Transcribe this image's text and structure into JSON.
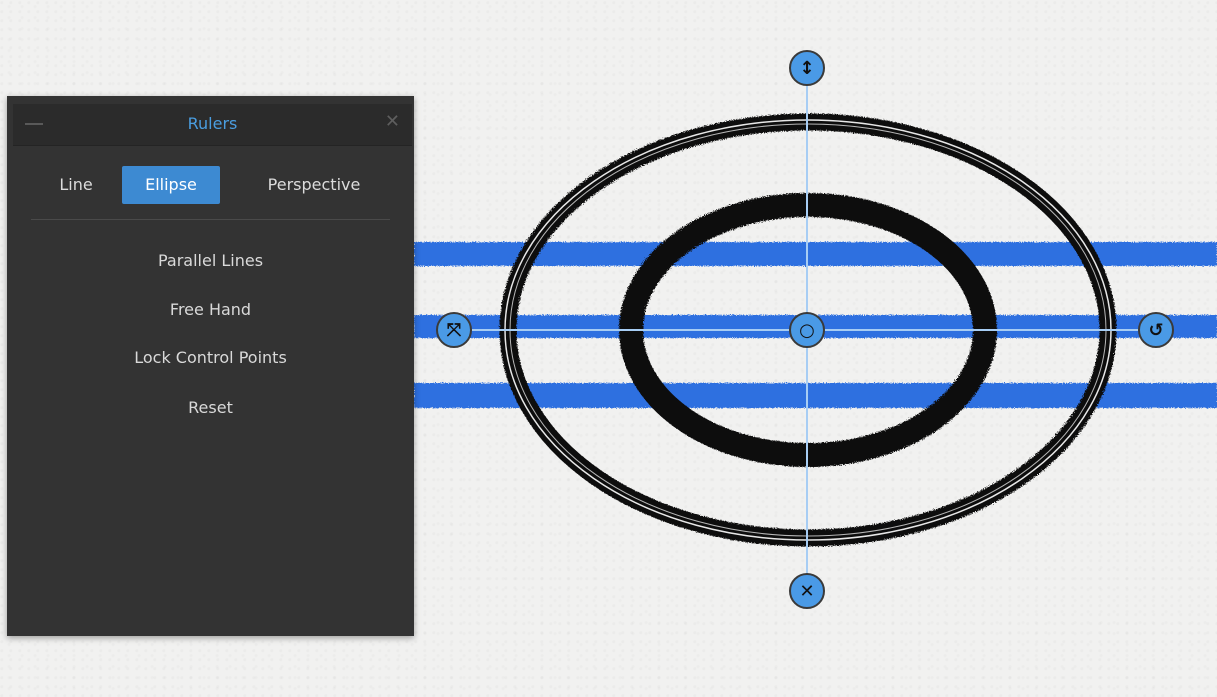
{
  "panel": {
    "title": "Rulers",
    "tabs": [
      {
        "label": "Line",
        "selected": false
      },
      {
        "label": "Ellipse",
        "selected": true
      },
      {
        "label": "Perspective",
        "selected": false
      }
    ],
    "menu_items": [
      "Parallel Lines",
      "Free Hand",
      "Lock Control Points",
      "Reset"
    ]
  },
  "handles": {
    "top": "vertical-resize-icon",
    "bottom": "delete-icon",
    "left": "scale-icon",
    "right": "rotate-icon",
    "center": "move-center-icon"
  },
  "colors": {
    "accent": "#3d8ad2",
    "handle": "#4a9ae6",
    "stroke_blue": "#2f6fe0",
    "stroke_black": "#0a0a0a",
    "panel_bg": "#333333"
  }
}
